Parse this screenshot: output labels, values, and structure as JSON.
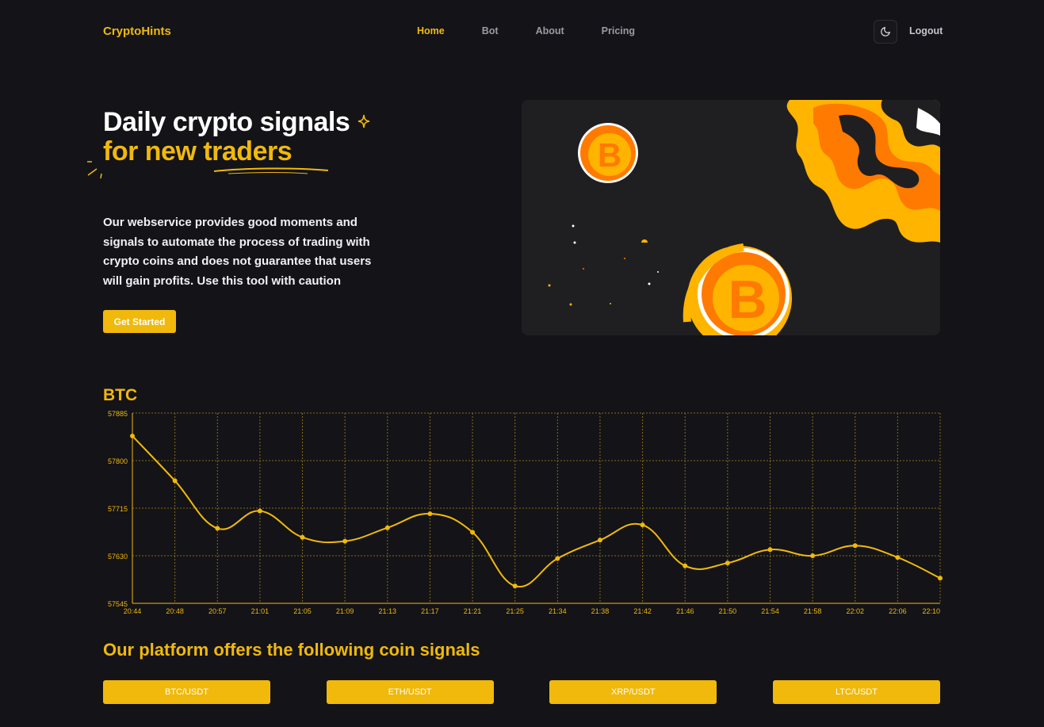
{
  "brand": "CryptoHints",
  "nav": {
    "items": [
      {
        "label": "Home",
        "active": true
      },
      {
        "label": "Bot",
        "active": false
      },
      {
        "label": "About",
        "active": false
      },
      {
        "label": "Pricing",
        "active": false
      }
    ],
    "theme_icon": "moon-icon",
    "logout": "Logout"
  },
  "hero": {
    "title_line1": "Daily crypto signals",
    "title_line2": "for new traders",
    "description": "Our webservice provides good moments and signals to automate the process of trading with crypto coins and does not guarantee that users will gain profits. Use this tool with caution",
    "cta": "Get Started"
  },
  "colors": {
    "accent": "#f0b90b",
    "background": "#131318",
    "grid": "#8a6d12"
  },
  "chart_data": {
    "type": "line",
    "title": "BTC",
    "x": [
      "20:44",
      "20:48",
      "20:57",
      "21:01",
      "21:05",
      "21:09",
      "21:13",
      "21:17",
      "21:21",
      "21:25",
      "21:34",
      "21:38",
      "21:42",
      "21:46",
      "21:50",
      "21:54",
      "21:58",
      "22:02",
      "22:06",
      "22:10"
    ],
    "values": [
      57844,
      57764,
      57679,
      57710,
      57663,
      57656,
      57680,
      57705,
      57672,
      57576,
      57625,
      57658,
      57685,
      57612,
      57617,
      57641,
      57630,
      57648,
      57627,
      57590
    ],
    "yticks": [
      57545,
      57630,
      57715,
      57800,
      57885
    ],
    "ylim": [
      57545,
      57885
    ],
    "grid": true,
    "line_color": "#f0b90b"
  },
  "signals": {
    "title": "Our platform offers the following coin signals",
    "items": [
      "BTC/USDT",
      "ETH/USDT",
      "XRP/USDT",
      "LTC/USDT"
    ]
  }
}
